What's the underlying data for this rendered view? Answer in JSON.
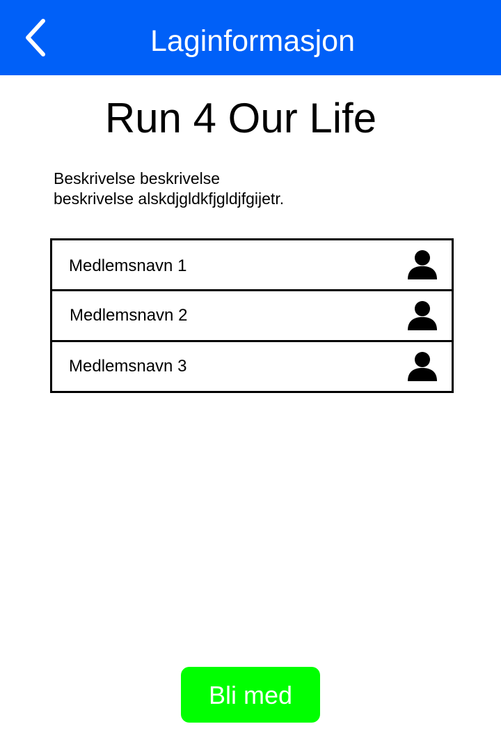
{
  "header": {
    "title": "Laginformasjon",
    "back_icon": "chevron-left-icon",
    "background_color": "#0060f8"
  },
  "team": {
    "name": "Run 4 Our Life",
    "description_line1": "Beskrivelse beskrivelse",
    "description_line2": "beskrivelse alskdjgldkfjgldjfgijetr."
  },
  "members": [
    {
      "name": "Medlemsnavn 1",
      "icon": "user-icon"
    },
    {
      "name": "Medlemsnavn 2",
      "icon": "user-icon"
    },
    {
      "name": "Medlemsnavn 3",
      "icon": "user-icon"
    }
  ],
  "join_button": {
    "label": "Bli med",
    "background_color": "#00ff00"
  }
}
